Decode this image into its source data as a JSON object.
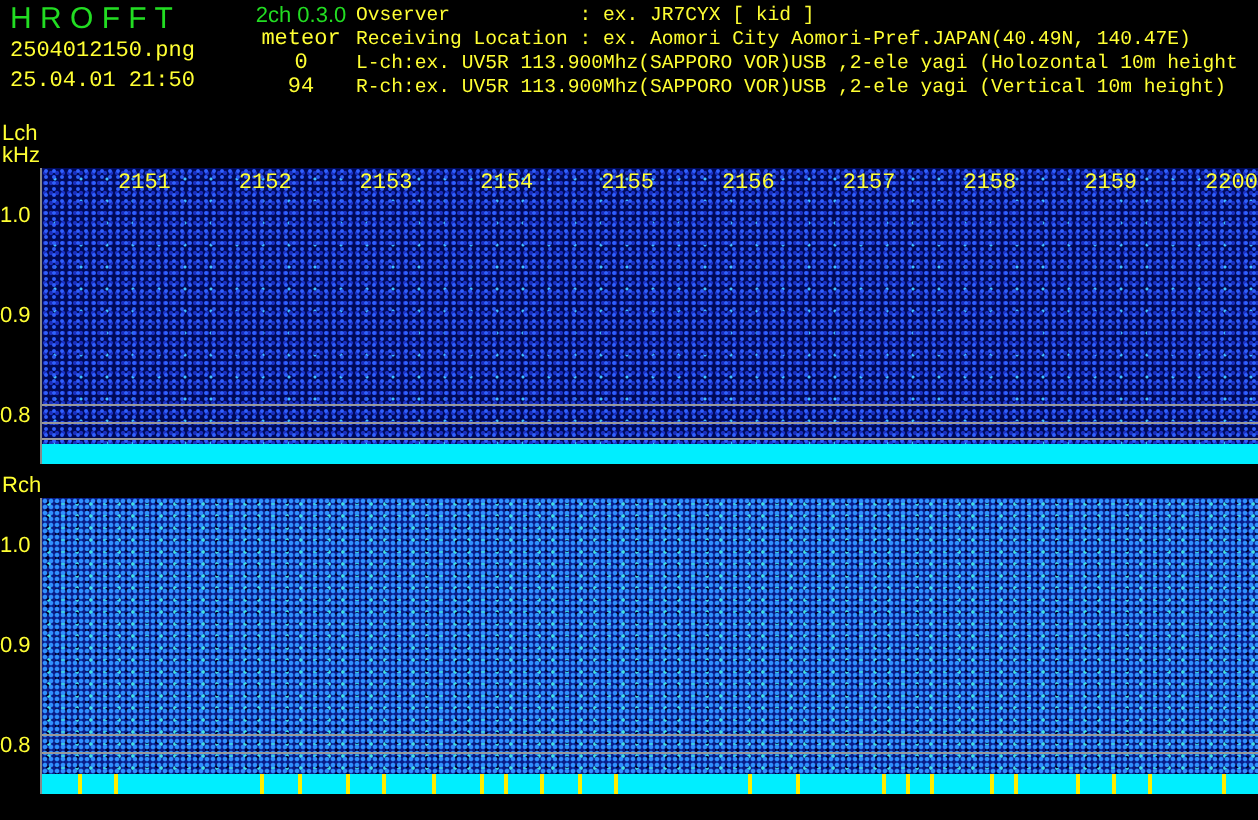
{
  "app": {
    "title": "H R O F F T",
    "version": "2ch 0.3.0",
    "filename": "2504012150.png",
    "datetime": "25.04.01 21:50",
    "meteor_label": "meteor",
    "meteor_counts": [
      "0",
      "94"
    ]
  },
  "info_lines": [
    "Ovserver           : ex. JR7CYX [ kid ]",
    "Receiving Location : ex. Aomori City Aomori-Pref.JAPAN(40.49N, 140.47E)",
    "L-ch:ex. UV5R 113.900Mhz(SAPPORO VOR)USB ,2-ele yagi (Holozontal 10m height",
    "R-ch:ex. UV5R 113.900Mhz(SAPPORO VOR)USB ,2-ele yagi (Vertical 10m height)"
  ],
  "x_labels": [
    "2151",
    "2152",
    "2153",
    "2154",
    "2155",
    "2156",
    "2157",
    "2158",
    "2159",
    "2200"
  ],
  "panels": [
    {
      "label": "Lch",
      "unit": "kHz",
      "kind": "calm",
      "y_labels": [
        "1.0",
        "0.9",
        "0.8"
      ]
    },
    {
      "label": "Rch",
      "kind": "busy",
      "y_labels": [
        "1.0",
        "0.9",
        "0.8"
      ]
    }
  ]
}
